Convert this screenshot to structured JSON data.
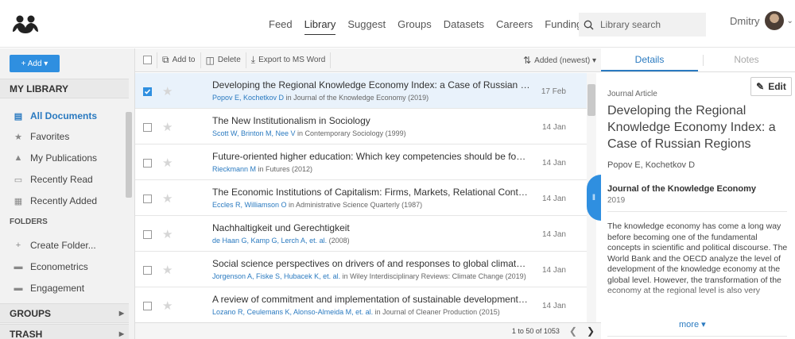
{
  "nav": {
    "links": [
      "Feed",
      "Library",
      "Suggest",
      "Groups",
      "Datasets",
      "Careers",
      "Funding"
    ],
    "active": "Library",
    "search_placeholder": "Library search",
    "user_name": "Dmitry"
  },
  "sidebar": {
    "add_label": "+ Add ▾",
    "my_library": "MY LIBRARY",
    "items": [
      {
        "label": "All Documents",
        "icon": "document-icon"
      },
      {
        "label": "Favorites",
        "icon": "star-icon"
      },
      {
        "label": "My Publications",
        "icon": "graduation-cap-icon"
      },
      {
        "label": "Recently Read",
        "icon": "book-icon"
      },
      {
        "label": "Recently Added",
        "icon": "calendar-icon"
      }
    ],
    "folders_label": "FOLDERS",
    "folders": [
      {
        "label": "Create Folder..."
      },
      {
        "label": "Econometrics"
      },
      {
        "label": "Engagement"
      }
    ],
    "groups_label": "GROUPS",
    "trash_label": "TRASH"
  },
  "toolbar": {
    "add_to": "Add to",
    "delete": "Delete",
    "export": "Export to MS Word",
    "sort": "Added (newest) ▾"
  },
  "documents": [
    {
      "title": "Developing the Regional Knowledge Economy Index: a Case of Russian Regions",
      "authors": "Popov E, Kochetkov D",
      "source": " in Journal of the Knowledge Economy (2019)",
      "date": "17 Feb",
      "selected": true
    },
    {
      "title": "The New Institutionalism in Sociology",
      "authors": "Scott W, Brinton M, Nee V",
      "source": " in Contemporary Sociology (1999)",
      "date": "14 Jan",
      "selected": false
    },
    {
      "title": "Future-oriented higher education: Which key competencies should be fostered through university teaching and learning?",
      "authors": "Rieckmann M",
      "source": " in Futures (2012)",
      "date": "14 Jan",
      "selected": false
    },
    {
      "title": "The Economic Institutions of Capitalism: Firms, Markets, Relational Contracting.",
      "authors": "Eccles R, Williamson O",
      "source": " in Administrative Science Quarterly (1987)",
      "date": "14 Jan",
      "selected": false
    },
    {
      "title": "Nachhaltigkeit und Gerechtigkeit",
      "authors": "de Haan G, Kamp G, Lerch A, et. al.",
      "source": " (2008)",
      "date": "14 Jan",
      "selected": false
    },
    {
      "title": "Social science perspectives on drivers of and responses to global climate change",
      "authors": "Jorgenson A, Fiske S, Hubacek K, et. al.",
      "source": " in Wiley Interdisciplinary Reviews: Climate Change (2019)",
      "date": "14 Jan",
      "selected": false
    },
    {
      "title": "A review of commitment and implementation of sustainable development in higher education",
      "authors": "Lozano R, Ceulemans K, Alonso-Almeida M, et. al.",
      "source": " in Journal of Cleaner Production (2015)",
      "date": "14 Jan",
      "selected": false
    }
  ],
  "pager": {
    "text": "1 to 50 of 1053"
  },
  "details": {
    "tab_details": "Details",
    "tab_notes": "Notes",
    "doc_type": "Journal Article",
    "edit_label": "Edit",
    "title": "Developing the Regional Knowledge Economy Index: a Case of Russian Regions",
    "authors": "Popov E,  Kochetkov D",
    "journal": "Journal of the Knowledge Economy",
    "year": "2019",
    "abstract": "The knowledge economy has come a long way before becoming one of the fundamental concepts in scientific and political discourse. The World Bank and the OECD analyze the level of development of the knowledge economy at the global level. However, the transformation of the economy at the regional level is also very",
    "more_label": "more ▾"
  },
  "colors": {
    "accent": "#2f8fe0",
    "link": "#2a7ac0"
  }
}
